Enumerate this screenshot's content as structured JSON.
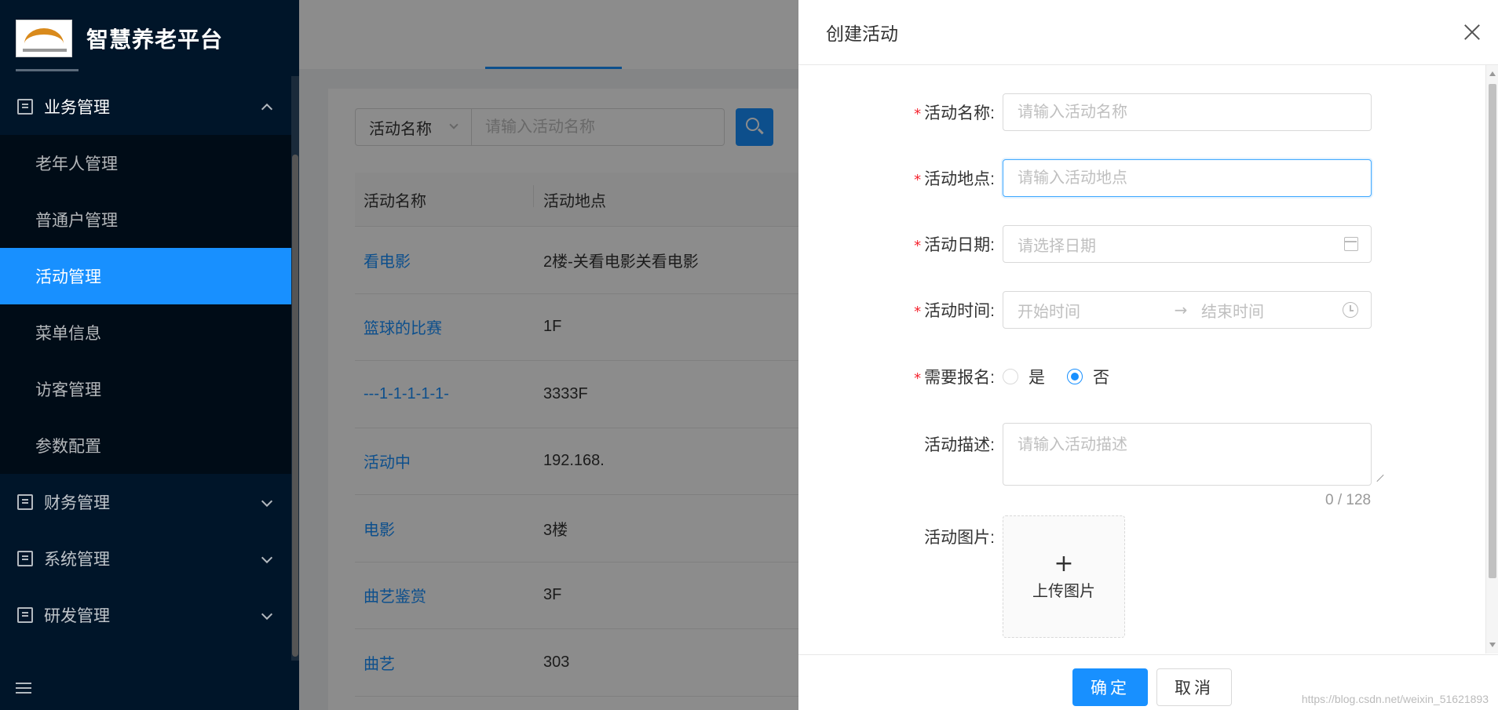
{
  "app": {
    "title": "智慧养老平台"
  },
  "sidebar": {
    "groups": [
      {
        "label": "业务管理",
        "icon": "document-icon",
        "expanded": true
      },
      {
        "label": "财务管理",
        "icon": "finance-icon",
        "expanded": false
      },
      {
        "label": "系统管理",
        "icon": "system-icon",
        "expanded": false
      },
      {
        "label": "研发管理",
        "icon": "dev-icon",
        "expanded": false
      }
    ],
    "items": [
      {
        "label": "老年人管理",
        "active": false
      },
      {
        "label": "普通户管理",
        "active": false
      },
      {
        "label": "活动管理",
        "active": true
      },
      {
        "label": "菜单信息",
        "active": false
      },
      {
        "label": "访客管理",
        "active": false
      },
      {
        "label": "参数配置",
        "active": false
      }
    ]
  },
  "search": {
    "field_select": "活动名称",
    "placeholder": "请输入活动名称"
  },
  "table": {
    "columns": [
      "活动名称",
      "活动地点"
    ],
    "rows": [
      [
        "看电影",
        "2楼-关看电影关看电影"
      ],
      [
        "篮球的比赛",
        "1F"
      ],
      [
        "---1-1-1-1-1-",
        "3333F"
      ],
      [
        "活动中",
        "192.168."
      ],
      [
        "电影",
        "3楼"
      ],
      [
        "曲艺鉴赏",
        "3F"
      ],
      [
        "曲艺",
        "303"
      ]
    ]
  },
  "drawer": {
    "title": "创建活动",
    "required_mark": "*",
    "fields": {
      "name": {
        "label": "活动名称:",
        "placeholder": "请输入活动名称"
      },
      "location": {
        "label": "活动地点:",
        "placeholder": "请输入活动地点"
      },
      "date": {
        "label": "活动日期:",
        "placeholder": "请选择日期"
      },
      "time": {
        "label": "活动时间:",
        "start_placeholder": "开始时间",
        "arrow": "→",
        "end_placeholder": "结束时间"
      },
      "signup": {
        "label": "需要报名:",
        "options": [
          "是",
          "否"
        ],
        "selected": "否"
      },
      "description": {
        "label": "活动描述:",
        "placeholder": "请输入活动描述",
        "counter": "0 / 128"
      },
      "image": {
        "label": "活动图片:",
        "plus": "+",
        "upload_text": "上传图片"
      }
    },
    "buttons": {
      "ok": "确定",
      "cancel": "取消"
    }
  },
  "watermark": "https://blog.csdn.net/weixin_51621893",
  "colors": {
    "primary": "#1890ff",
    "sidebar_bg": "#001529",
    "required": "#f5222d"
  }
}
